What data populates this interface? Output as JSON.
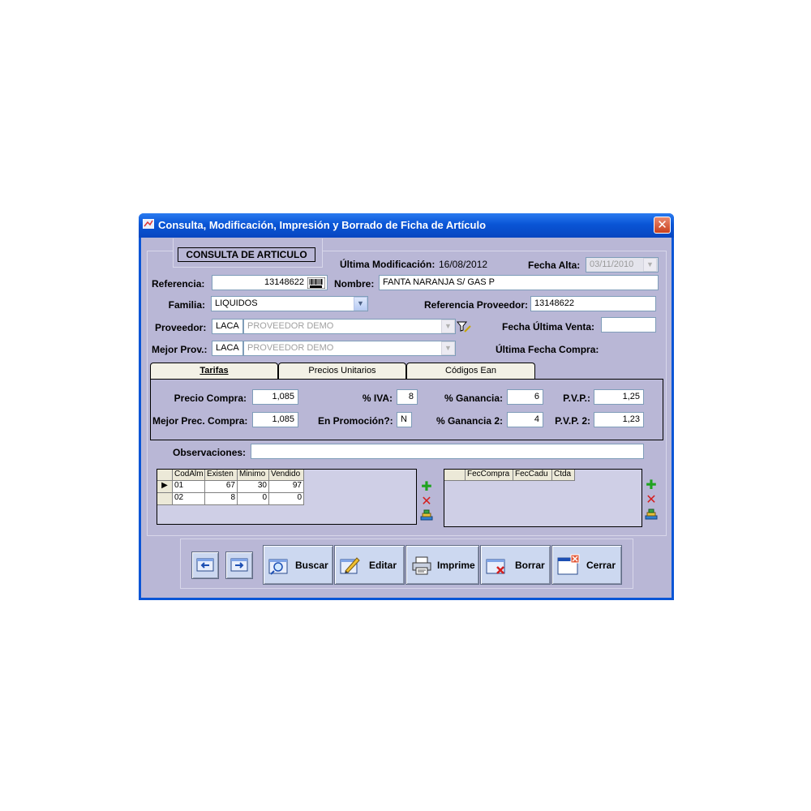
{
  "window": {
    "title": "Consulta, Modificación, Impresión y Borrado de Ficha de Artículo",
    "close_glyph": "✕"
  },
  "header": {
    "section_title": "CONSULTA DE ARTICULO",
    "ultima_modificacion_label": "Última Modificación:",
    "ultima_modificacion_value": "16/08/2012",
    "fecha_alta_label": "Fecha Alta:",
    "fecha_alta_value": "03/11/2010"
  },
  "form": {
    "referencia_label": "Referencia:",
    "referencia_value": "13148622",
    "nombre_label": "Nombre:",
    "nombre_value": "FANTA NARANJA S/ GAS P",
    "familia_label": "Familia:",
    "familia_value": "LIQUIDOS",
    "ref_proveedor_label": "Referencia Proveedor:",
    "ref_proveedor_value": "13148622",
    "proveedor_label": "Proveedor:",
    "proveedor_code": "LACA",
    "proveedor_name": "PROVEEDOR DEMO",
    "fecha_ultima_venta_label": "Fecha Última Venta:",
    "fecha_ultima_venta_value": "",
    "mejor_prov_label": "Mejor Prov.:",
    "mejor_prov_code": "LACA",
    "mejor_prov_name": "PROVEEDOR DEMO",
    "ultima_fecha_compra_label": "Última Fecha Compra:",
    "observaciones_label": "Observaciones:",
    "observaciones_value": ""
  },
  "tabs": [
    {
      "label": "Tarifas",
      "active": true
    },
    {
      "label": "Precios Unitarios",
      "active": false
    },
    {
      "label": "Códigos Ean",
      "active": false
    }
  ],
  "tarifas": {
    "precio_compra_label": "Precio Compra:",
    "precio_compra_value": "1,085",
    "mejor_prec_compra_label": "Mejor Prec. Compra:",
    "mejor_prec_compra_value": "1,085",
    "iva_label": "% IVA:",
    "iva_value": "8",
    "promocion_label": "En Promoción?:",
    "promocion_value": "N",
    "ganancia_label": "% Ganancia:",
    "ganancia_value": "6",
    "ganancia2_label": "% Ganancia 2:",
    "ganancia2_value": "4",
    "pvp_label": "P.V.P.:",
    "pvp_value": "1,25",
    "pvp2_label": "P.V.P. 2:",
    "pvp2_value": "1,23"
  },
  "stock_grid": {
    "columns": [
      "CodAlm",
      "Existen",
      "Minimo",
      "Vendido"
    ],
    "rows": [
      [
        "01",
        "67",
        "30",
        "97"
      ],
      [
        "02",
        "8",
        "0",
        "0"
      ]
    ]
  },
  "compras_grid": {
    "columns": [
      "FecCompra",
      "FecCadu",
      "Ctda"
    ],
    "rows": []
  },
  "buttons": {
    "prev_glyph": "⇦",
    "next_glyph": "⇨",
    "buscar": "Buscar",
    "editar": "Editar",
    "imprime": "Imprime",
    "borrar": "Borrar",
    "cerrar": "Cerrar"
  },
  "colors": {
    "window_blue": "#0a55d6",
    "client_bg": "#b9b7d6",
    "button_bg": "#ccd8f0"
  }
}
